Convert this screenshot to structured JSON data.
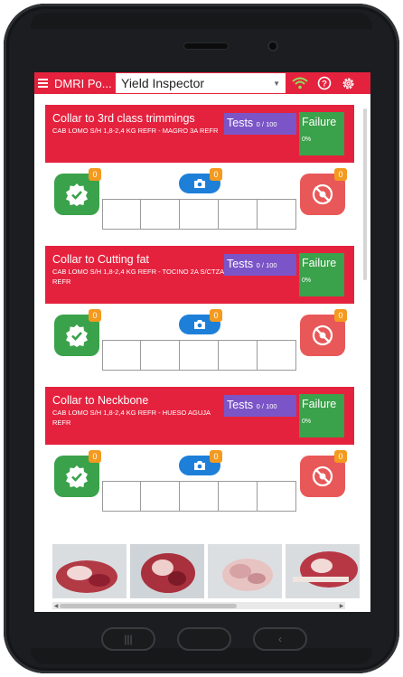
{
  "app": {
    "title": "DMRI Po...",
    "dropdown_value": "Yield Inspector"
  },
  "cards": [
    {
      "title": "Collar to 3rd class trimmings",
      "subtitle": "CAB LOMO S/H 1,8-2,4 KG REFR - MAGRO 3A REFR",
      "tests_label": "Tests",
      "tests_count": "0 / 100",
      "failure_label": "Failure",
      "failure_pct": "0%",
      "ok_badge": "0",
      "camera_badge": "0",
      "fail_badge": "0"
    },
    {
      "title": "Collar to Cutting fat",
      "subtitle": "CAB LOMO S/H 1,8-2,4 KG REFR - TOCINO 2A S/CTZA REFR",
      "tests_label": "Tests",
      "tests_count": "0 / 100",
      "failure_label": "Failure",
      "failure_pct": "0%",
      "ok_badge": "0",
      "camera_badge": "0",
      "fail_badge": "0"
    },
    {
      "title": "Collar to Neckbone",
      "subtitle": "CAB LOMO S/H 1,8-2,4 KG REFR - HUESO AGUJA REFR",
      "tests_label": "Tests",
      "tests_count": "0 / 100",
      "failure_label": "Failure",
      "failure_pct": "0%",
      "ok_badge": "0",
      "camera_badge": "0",
      "fail_badge": "0"
    }
  ],
  "colors": {
    "header_red": "#e5223e",
    "tests_purple": "#7b55c7",
    "ok_green": "#3aa24a",
    "fail_red": "#e85858",
    "badge_orange": "#f39a1f",
    "camera_blue": "#1d7fd8"
  },
  "icons": [
    "menu-icon",
    "wifi-icon",
    "help-icon",
    "settings-icon",
    "checkmark-badge-icon",
    "camera-icon",
    "no-photo-icon"
  ]
}
